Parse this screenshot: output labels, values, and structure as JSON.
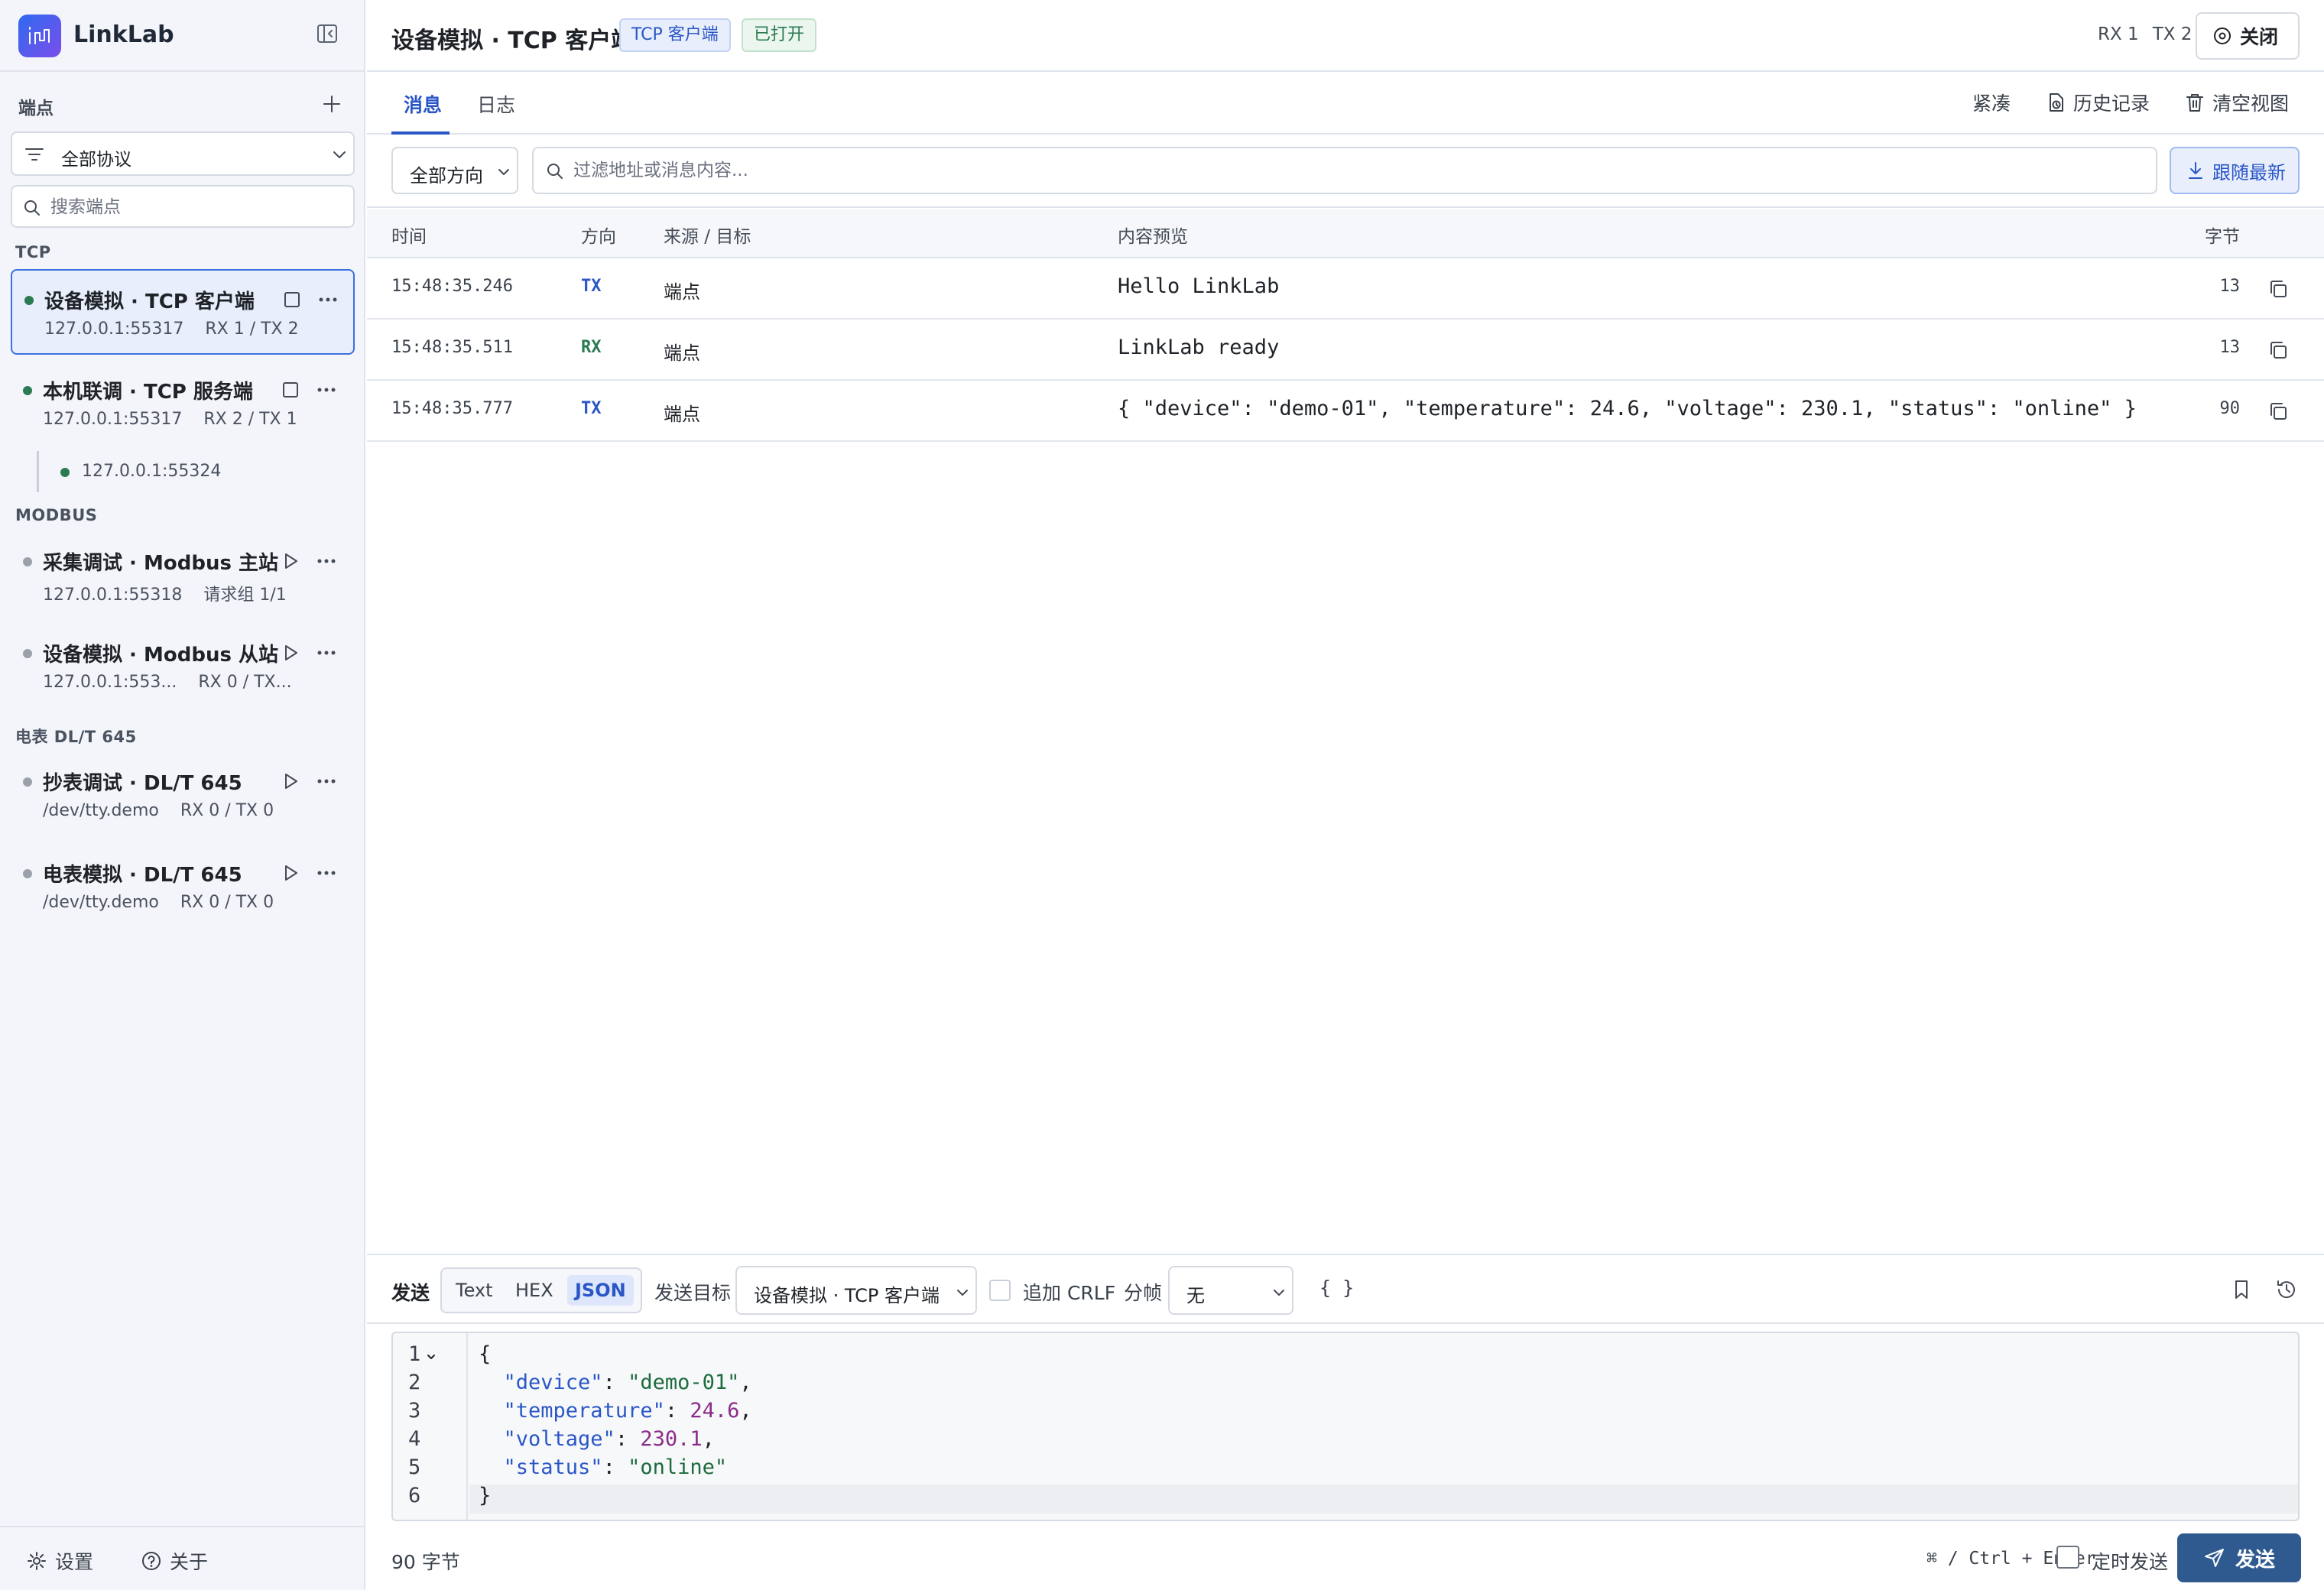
{
  "app": {
    "name": "LinkLab"
  },
  "sidebar": {
    "endpoints_title": "端点",
    "protocol_filter": "全部协议",
    "search_placeholder": "搜索端点",
    "groups": {
      "tcp": "TCP",
      "modbus": "MODBUS",
      "dlt645": "电表 DL/T 645"
    },
    "endpoints": [
      {
        "name": "设备模拟 · TCP 客户端",
        "addr": "127.0.0.1:55317",
        "stats": "RX 1 / TX 2",
        "status": "connected",
        "selected": true
      },
      {
        "name": "本机联调 · TCP 服务端",
        "addr": "127.0.0.1:55317",
        "stats": "RX 2 / TX 1",
        "status": "connected",
        "child": "127.0.0.1:55324"
      },
      {
        "name": "采集调试 · Modbus 主站",
        "addr": "127.0.0.1:55318",
        "stats": "请求组 1/1",
        "status": "idle"
      },
      {
        "name": "设备模拟 · Modbus 从站",
        "addr": "127.0.0.1:553...",
        "stats": "RX 0 / TX...",
        "status": "idle"
      },
      {
        "name": "抄表调试 · DL/T 645",
        "addr": "/dev/tty.demo",
        "stats": "RX 0 / TX 0",
        "status": "idle"
      },
      {
        "name": "电表模拟 · DL/T 645",
        "addr": "/dev/tty.demo",
        "stats": "RX 0 / TX 0",
        "status": "idle"
      }
    ],
    "footer": {
      "settings": "设置",
      "about": "关于"
    }
  },
  "header": {
    "title": "设备模拟 · TCP 客户端",
    "type_badge": "TCP 客户端",
    "state_badge": "已打开",
    "rx": "RX 1",
    "tx": "TX 2",
    "close_label": "关闭"
  },
  "tabs": [
    {
      "label": "消息",
      "active": true
    },
    {
      "label": "日志",
      "active": false
    }
  ],
  "tab_actions": {
    "compact": "紧凑",
    "history": "历史记录",
    "clear": "清空视图"
  },
  "filters": {
    "direction": "全部方向",
    "search_placeholder": "过滤地址或消息内容...",
    "follow_label": "跟随最新"
  },
  "table": {
    "columns": {
      "time": "时间",
      "direction": "方向",
      "source": "来源 / 目标",
      "preview": "内容预览",
      "bytes": "字节"
    },
    "rows": [
      {
        "time": "15:48:35.246",
        "dir": "TX",
        "src": "端点",
        "preview": "Hello LinkLab",
        "bytes": "13"
      },
      {
        "time": "15:48:35.511",
        "dir": "RX",
        "src": "端点",
        "preview": "LinkLab ready",
        "bytes": "13"
      },
      {
        "time": "15:48:35.777",
        "dir": "TX",
        "src": "端点",
        "preview": "{ \"device\": \"demo-01\", \"temperature\": 24.6, \"voltage\": 230.1, \"status\": \"online\" }",
        "bytes": "90"
      }
    ]
  },
  "send": {
    "label": "发送",
    "formats": [
      "Text",
      "HEX",
      "JSON"
    ],
    "active_format": "JSON",
    "target_label": "发送目标",
    "target": "设备模拟 · TCP 客户端",
    "crlf_label": "追加 CRLF",
    "frame_label": "分帧",
    "frame_value": "无",
    "format_json": "{ }"
  },
  "editor": {
    "lines": [
      "{",
      "  \"device\": \"demo-01\",",
      "  \"temperature\": 24.6,",
      "  \"voltage\": 230.1,",
      "  \"status\": \"online\"",
      "}"
    ]
  },
  "footer": {
    "bytes": "90 字节",
    "shortcut": "⌘ / Ctrl + Enter",
    "schedule_label": "定时发送",
    "send_button": "发送"
  },
  "colors": {
    "accent": "#2a56c6",
    "connected": "#2c7a52",
    "send_button": "#2f5a8f"
  }
}
